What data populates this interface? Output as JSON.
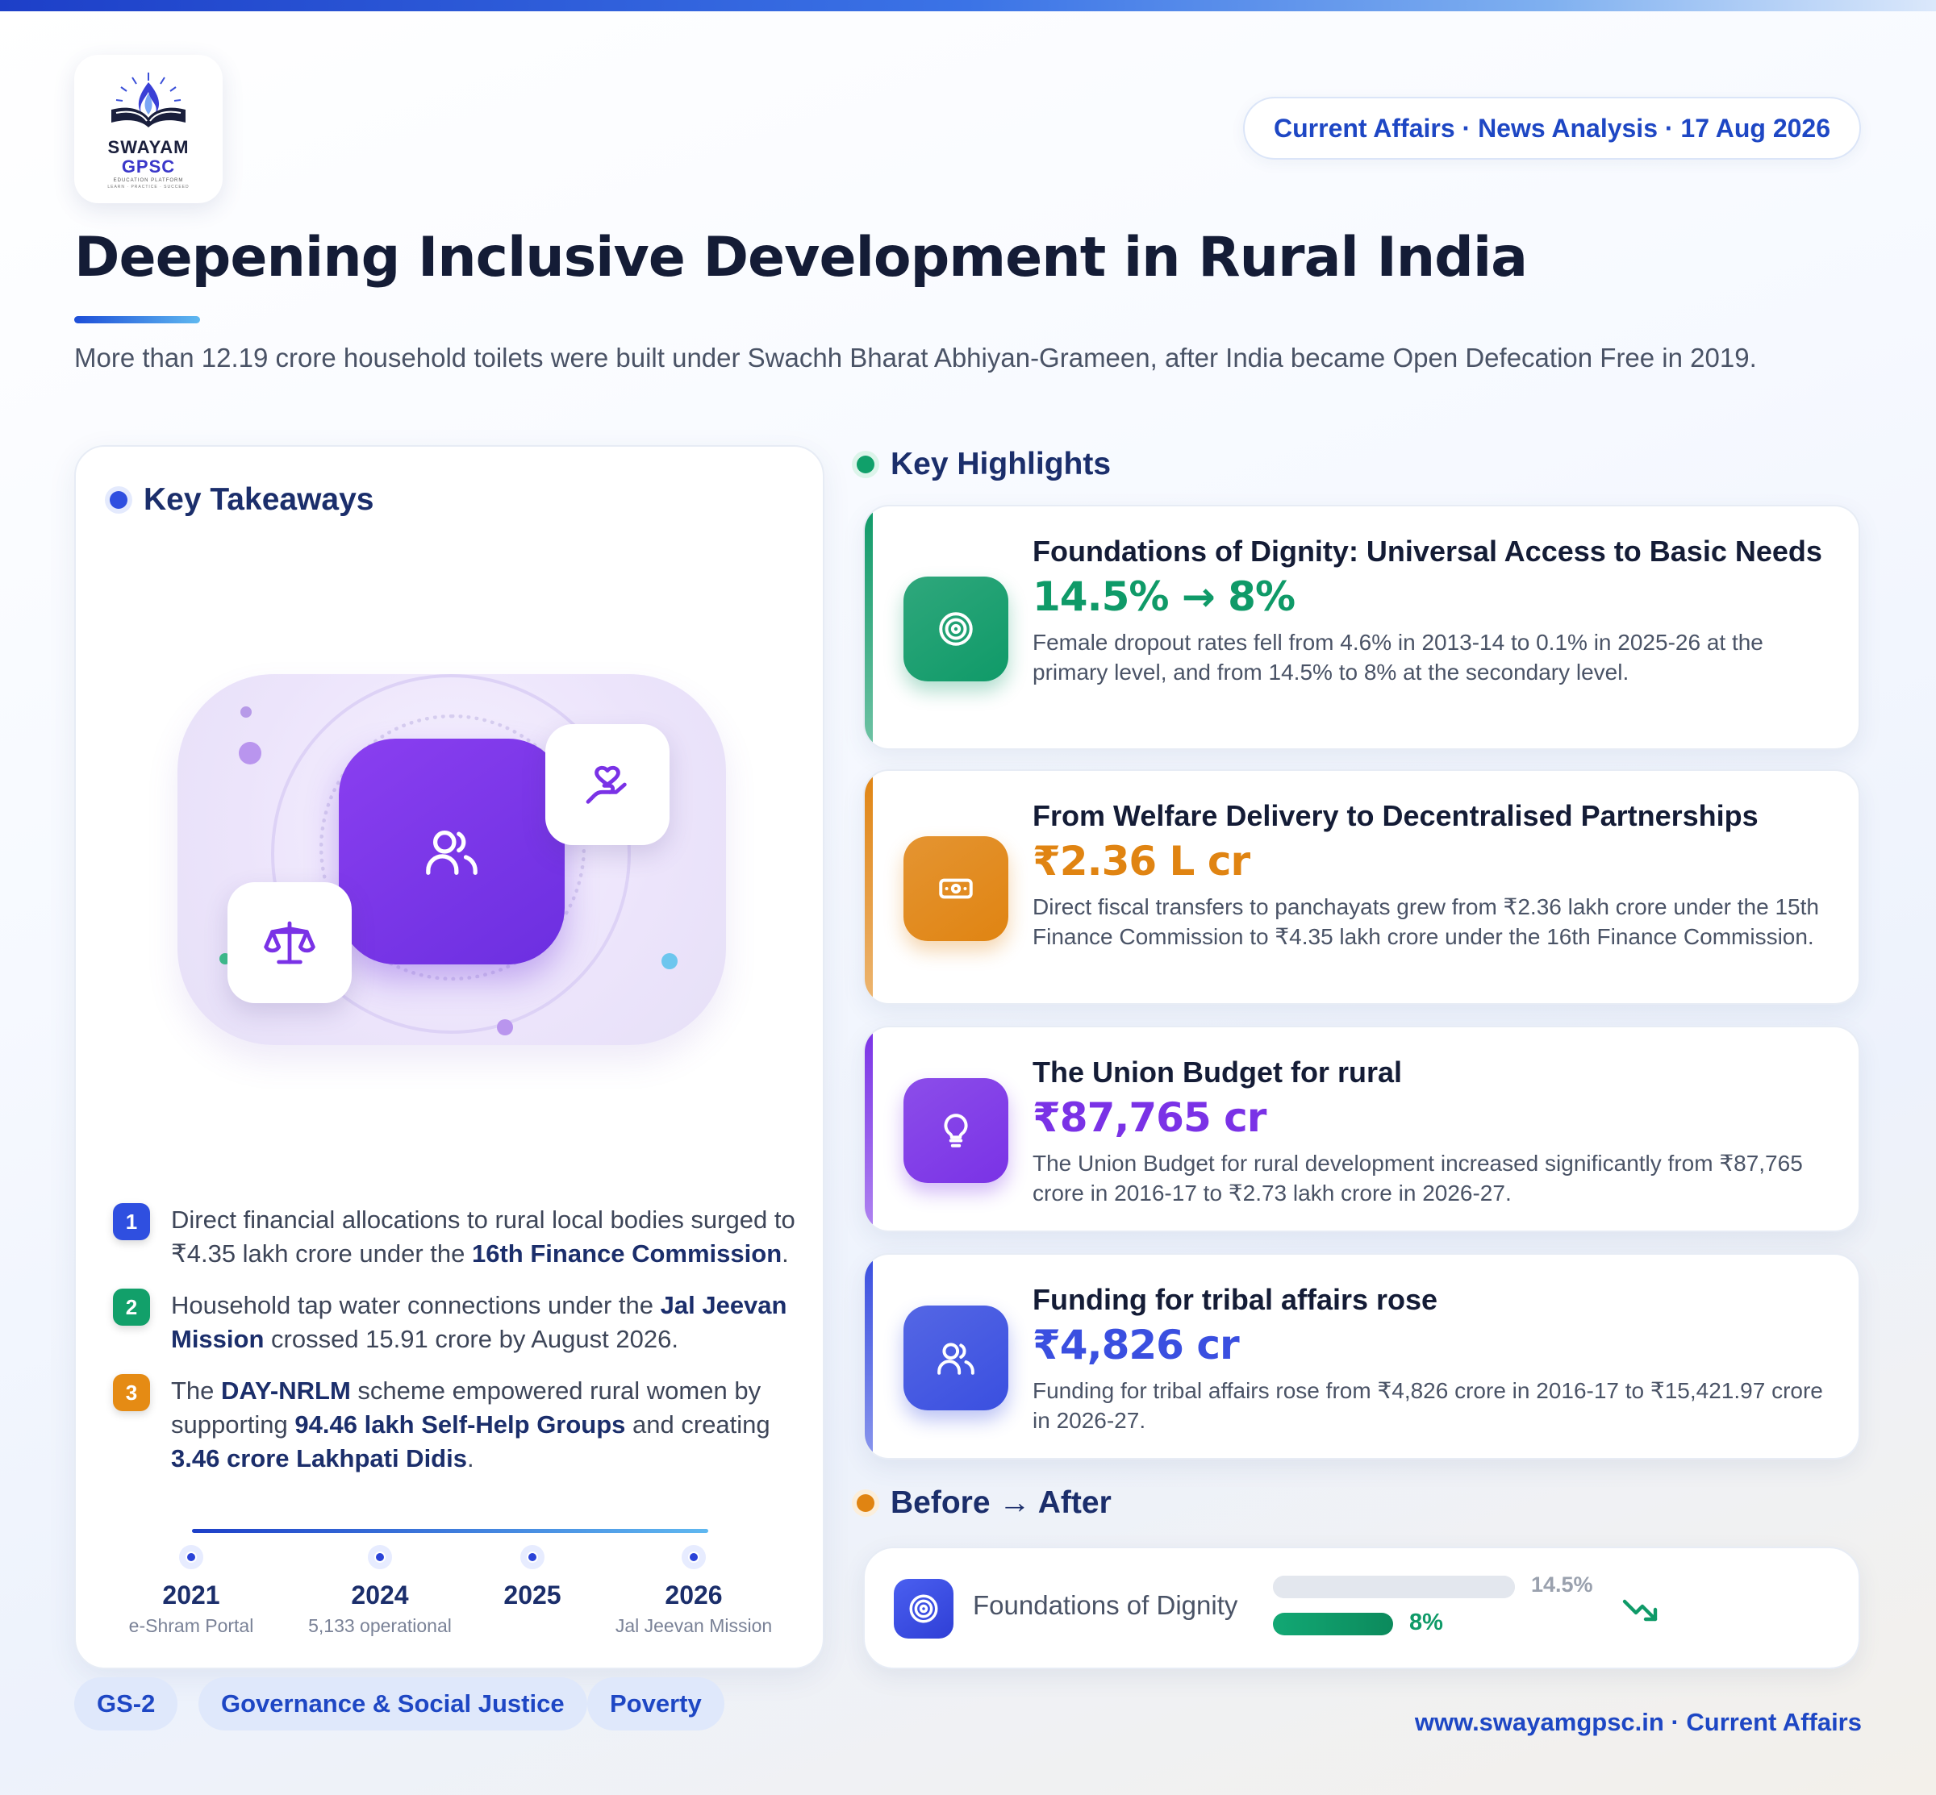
{
  "header": {
    "logo": {
      "line1": "SWAYAM",
      "line2": "GPSC",
      "line3": "EDUCATION PLATFORM",
      "line4": "LEARN · PRACTICE · SUCCEED"
    },
    "date_pill": "Current Affairs · News Analysis · 17 Aug 2026",
    "title": "Deepening Inclusive Development in Rural India",
    "subtitle": "More than 12.19 crore household toilets were built under Swachh Bharat Abhiyan-Grameen, after India became Open Defecation Free in 2019."
  },
  "takeaways": {
    "heading": "Key Takeaways",
    "items": [
      {
        "num": "1",
        "color": "#2f4fe0",
        "parts": [
          [
            "t",
            "Direct financial allocations to rural local bodies surged to ₹4.35 lakh crore under the "
          ],
          [
            "b",
            "16th Finance Commission"
          ],
          [
            "t",
            "."
          ]
        ]
      },
      {
        "num": "2",
        "color": "#12a06a",
        "parts": [
          [
            "t",
            "Household tap water connections under the "
          ],
          [
            "b",
            "Jal Jeevan Mission"
          ],
          [
            "t",
            " crossed 15.91 crore by August 2026."
          ]
        ]
      },
      {
        "num": "3",
        "color": "#e58b14",
        "parts": [
          [
            "t",
            "The "
          ],
          [
            "b",
            "DAY-NRLM"
          ],
          [
            "t",
            " scheme empowered rural women by supporting "
          ],
          [
            "b",
            "94.46 lakh Self-Help Groups"
          ],
          [
            "t",
            " and creating "
          ],
          [
            "b",
            "3.46 crore Lakhpati Didis"
          ],
          [
            "t",
            "."
          ]
        ]
      }
    ],
    "timeline": [
      {
        "year": "2021",
        "label": "e-Shram Portal"
      },
      {
        "year": "2024",
        "label": "5,133 operational"
      },
      {
        "year": "2025",
        "label": ""
      },
      {
        "year": "2026",
        "label": "Jal Jeevan Mission"
      }
    ]
  },
  "highlights": {
    "heading": "Key Highlights",
    "cards": [
      {
        "title": "Foundations of Dignity: Universal Access to Basic Needs",
        "value": "14.5% → 8%",
        "color": "#0f9a68",
        "icon": "target-icon",
        "desc": "Female dropout rates fell from 4.6% in 2013-14 to 0.1% in 2025-26 at the primary level, and from 14.5% to 8% at the secondary level."
      },
      {
        "title": "From Welfare Delivery to Decentralised Partnerships",
        "value": "₹2.36 L cr",
        "color": "#e08412",
        "icon": "banknote-icon",
        "desc": "Direct fiscal transfers to panchayats grew from ₹2.36 lakh crore under the 15th Finance Commission to ₹4.35 lakh crore under the 16th Finance Commission."
      },
      {
        "title": "The Union Budget for rural",
        "value": "₹87,765 cr",
        "color": "#7a32e6",
        "icon": "lightbulb-icon",
        "desc": "The Union Budget for rural development increased significantly from ₹87,765 crore in 2016-17 to ₹2.73 lakh crore in 2026-27."
      },
      {
        "title": "Funding for tribal affairs rose",
        "value": "₹4,826 cr",
        "color": "#3a4fe0",
        "icon": "users-icon",
        "desc": "Funding for tribal affairs rose from ₹4,826 crore in 2016-17 to ₹15,421.97 crore in 2026-27."
      }
    ]
  },
  "before_after": {
    "heading": "Before → After",
    "label": "Foundations of Dignity",
    "before": "14.5%",
    "after": "8%",
    "before_value": 14.5,
    "after_value": 8
  },
  "footer": {
    "tags": [
      "GS-2",
      "Governance & Social Justice",
      "Poverty"
    ],
    "site": "www.swayamgpsc.in · Current Affairs"
  }
}
